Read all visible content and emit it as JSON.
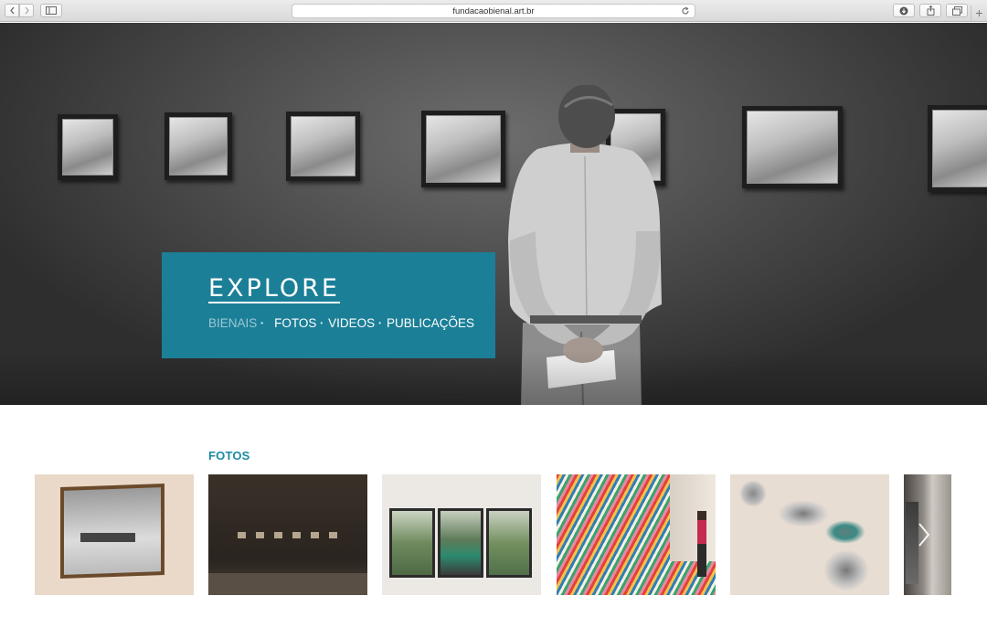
{
  "browser": {
    "url": "fundacaobienal.art.br",
    "back_icon": "chevron-left-icon",
    "forward_icon": "chevron-right-icon",
    "sidebar_icon": "sidebar-icon",
    "reload_icon": "reload-icon",
    "download_icon": "download-icon",
    "share_icon": "share-icon",
    "tabs_icon": "tabs-icon",
    "new_tab_label": "+"
  },
  "hero": {
    "title": "EXPLORE",
    "links": [
      {
        "label": "BIENAIS",
        "active": true
      },
      {
        "label": "FOTOS",
        "active": false
      },
      {
        "label": "VIDEOS",
        "active": false
      },
      {
        "label": "PUBLICAÇÕES",
        "active": false
      }
    ],
    "separator": "•",
    "accent_color": "#1b7f97"
  },
  "fotos": {
    "title": "FOTOS",
    "title_color": "#1b8aa3",
    "next_icon": "chevron-right-icon"
  }
}
